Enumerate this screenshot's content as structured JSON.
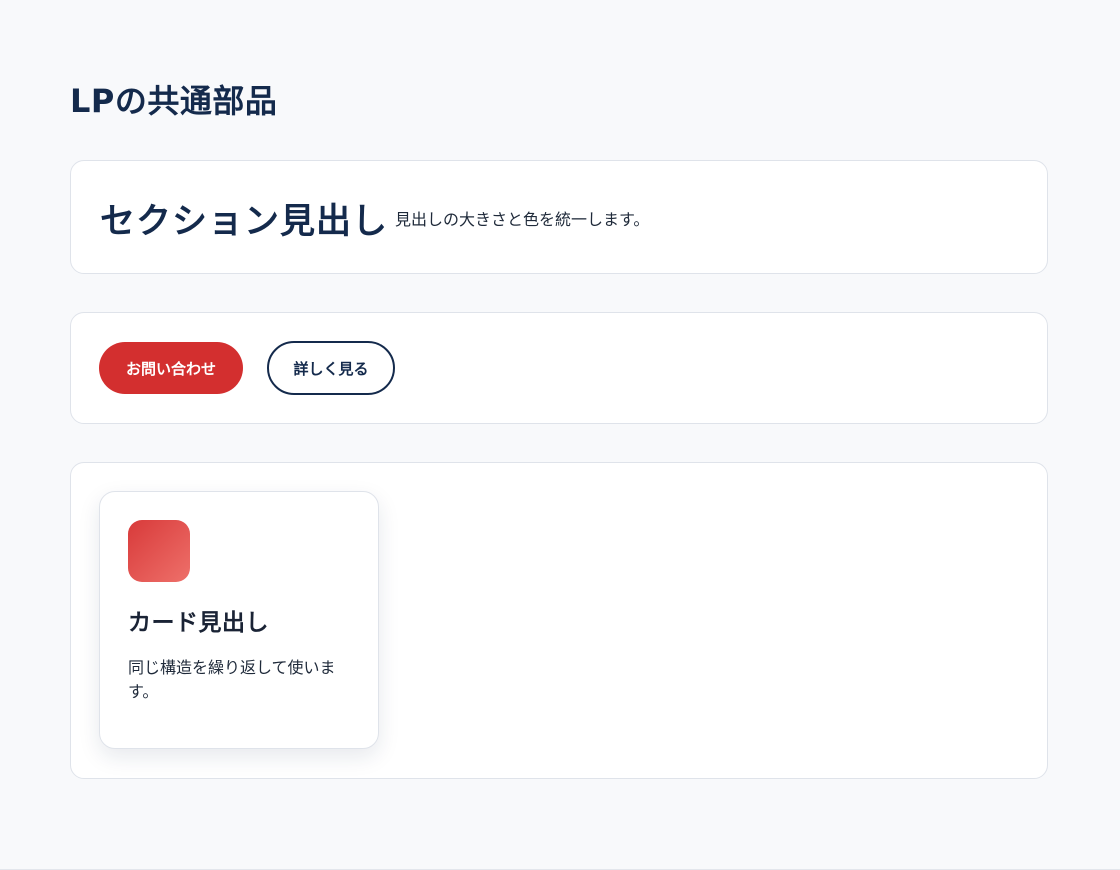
{
  "page": {
    "title": "LPの共通部品"
  },
  "heading_sample": {
    "heading": "セクション見出し",
    "note": "見出しの大きさと色を統一します。"
  },
  "buttons": {
    "primary_label": "お問い合わせ",
    "secondary_label": "詳しく見る"
  },
  "card": {
    "icon": "card-icon-square",
    "title": "カード見出し",
    "text": "同じ構造を繰り返して使います。"
  },
  "colors": {
    "primary": "#d32f2f",
    "navy": "#142a4c",
    "background": "#f8f9fb"
  }
}
